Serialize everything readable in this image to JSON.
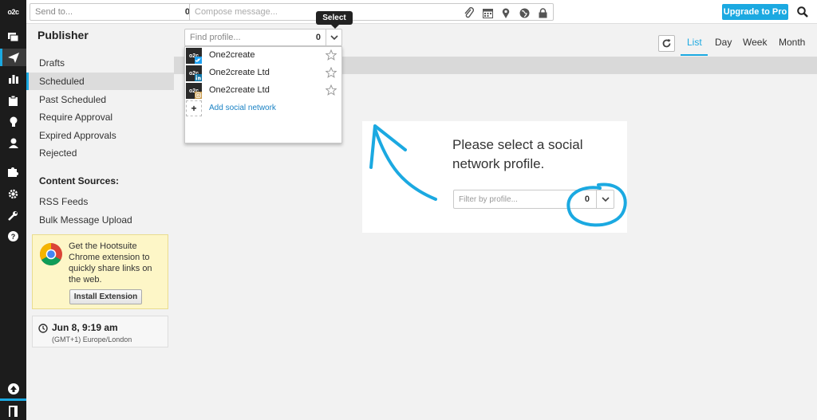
{
  "app": {
    "logo_text": "o2c"
  },
  "topbar": {
    "send_to_placeholder": "Send to...",
    "send_to_count": "0",
    "compose_placeholder": "Compose message...",
    "upgrade_label": "Upgrade to Pro"
  },
  "tooltip": {
    "text": "Select"
  },
  "profile_picker": {
    "find_placeholder": "Find profile...",
    "count": "0",
    "profiles": [
      {
        "name": "One2create",
        "network": "twitter"
      },
      {
        "name": "One2create Ltd",
        "network": "linkedin"
      },
      {
        "name": "One2create Ltd",
        "network": "instagram"
      }
    ],
    "add_label": "Add social network"
  },
  "sidebar": {
    "title": "Publisher",
    "items": [
      {
        "label": "Drafts"
      },
      {
        "label": "Scheduled",
        "active": true
      },
      {
        "label": "Past Scheduled"
      },
      {
        "label": "Require Approval"
      },
      {
        "label": "Expired Approvals"
      },
      {
        "label": "Rejected"
      }
    ],
    "content_sources_heading": "Content Sources:",
    "content_sources": [
      {
        "label": "RSS Feeds"
      },
      {
        "label": "Bulk Message Upload"
      }
    ],
    "chrome_promo": {
      "text": "Get the Hootsuite Chrome extension to quickly share links on the web.",
      "button": "Install Extension"
    },
    "time": {
      "main": "Jun 8, 9:19 am",
      "zone": "(GMT+1) Europe/London"
    }
  },
  "views": {
    "tabs": [
      "List",
      "Day",
      "Week",
      "Month"
    ],
    "active": "List"
  },
  "empty_state": {
    "message": "Please select a social network profile.",
    "filter_placeholder": "Filter by profile...",
    "filter_count": "0"
  },
  "colors": {
    "accent": "#1ba9e1",
    "rail": "#1c1c1c",
    "promo_bg": "#fdf6c7",
    "annotation": "#1ba9e1"
  }
}
